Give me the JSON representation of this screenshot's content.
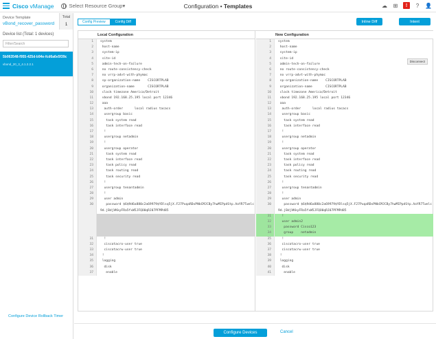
{
  "header": {
    "brand": "Cisco",
    "product": "vManage",
    "resource_group": "Select Resource Group▾",
    "title_section": "Configuration",
    "title_page": "Templates",
    "alert_count": "!"
  },
  "sidebar": {
    "device_template_label": "Device Template",
    "device_template_name": "vBond_recover_password",
    "total_label": "Total",
    "total_value": "1",
    "device_list": "Device list (Total: 1 devices)",
    "filter_placeholder": "Filter/Search",
    "device_id": "5b063548-f955-425d-b94e-fcd6a6e5f39c",
    "device_version": "vbond_20_3_4.1.2.2.1",
    "rollback_link": "Configure Device Rollback Timer"
  },
  "tabs": [
    {
      "label": "Config Preview"
    },
    {
      "label": "Config Diff"
    }
  ],
  "buttons": {
    "inline_diff": "Inline Diff",
    "intent": "Intent",
    "configure_devices": "Configure Devices",
    "cancel": "Cancel",
    "disconnect": "Disconnect"
  },
  "left_pane": {
    "title": "Local Configuration",
    "lines": [
      {
        "n": "1",
        "t": "system"
      },
      {
        "n": "2",
        "t": " host-name"
      },
      {
        "n": "3",
        "t": " system-ip"
      },
      {
        "n": "4",
        "t": " site-id"
      },
      {
        "n": "5",
        "t": " admin-tech-on-failure"
      },
      {
        "n": "6",
        "t": " no route-consistency-check"
      },
      {
        "n": "7",
        "t": " no vrrp-advt-with-phymac"
      },
      {
        "n": "8",
        "t": " sp-organization-name    CISCORTPLAB"
      },
      {
        "n": "9",
        "t": " organization-name       CISCORTPLAB"
      },
      {
        "n": "10",
        "t": " clock timezone America/Detroit"
      },
      {
        "n": "11",
        "t": " vbond 192.168.25.195 local port 12346"
      },
      {
        "n": "12",
        "t": " aaa"
      },
      {
        "n": "13",
        "t": "  auth-order      local radius tacacs"
      },
      {
        "n": "14",
        "t": "  usergroup basic"
      },
      {
        "n": "15",
        "t": "   task system read"
      },
      {
        "n": "16",
        "t": "   task interface read"
      },
      {
        "n": "17",
        "t": "  !"
      },
      {
        "n": "18",
        "t": "  usergroup netadmin"
      },
      {
        "n": "19",
        "t": "  !"
      },
      {
        "n": "20",
        "t": "  usergroup operator"
      },
      {
        "n": "21",
        "t": "   task system read"
      },
      {
        "n": "22",
        "t": "   task interface read"
      },
      {
        "n": "23",
        "t": "   task policy read"
      },
      {
        "n": "24",
        "t": "   task routing read"
      },
      {
        "n": "25",
        "t": "   task security read"
      },
      {
        "n": "26",
        "t": "  !"
      },
      {
        "n": "27",
        "t": "  usergroup tenantadmin"
      },
      {
        "n": "28",
        "t": "  !"
      },
      {
        "n": "29",
        "t": "  user admin"
      },
      {
        "n": "30",
        "t": "   password $6$9d6a880c2a69979$YDlsq5jX.F27PuqaRDxPNbCMJCBy7hwMIPpdStp.AaYR7Twelc9d.jBdjVKkyFRa5fxW5JFQO0qRJ07PFMPd85",
        "tall": true
      },
      {
        "n": "",
        "t": "",
        "blank": true
      },
      {
        "n": "",
        "t": "",
        "blank": true
      },
      {
        "n": "",
        "t": "",
        "blank": true
      },
      {
        "n": "",
        "t": "",
        "blank": true
      },
      {
        "n": "31",
        "t": "  !"
      },
      {
        "n": "32",
        "t": "  ciscotacro-user true"
      },
      {
        "n": "33",
        "t": "  ciscotacrw-user true"
      },
      {
        "n": "34",
        "t": " !"
      },
      {
        "n": "35",
        "t": " logging"
      },
      {
        "n": "36",
        "t": "  disk"
      },
      {
        "n": "37",
        "t": "   enable"
      }
    ]
  },
  "right_pane": {
    "title": "New Configuration",
    "lines": [
      {
        "n": "1",
        "t": "system"
      },
      {
        "n": "2",
        "t": " host-name"
      },
      {
        "n": "3",
        "t": " system-ip"
      },
      {
        "n": "4",
        "t": " site-id"
      },
      {
        "n": "5",
        "t": " admin-tech-on-failure"
      },
      {
        "n": "6",
        "t": " no route-consistency-check"
      },
      {
        "n": "7",
        "t": " no vrrp-advt-with-phymac"
      },
      {
        "n": "8",
        "t": " sp-organization-name    CISCORTPLAB"
      },
      {
        "n": "9",
        "t": " organization-name       CISCORTPLAB"
      },
      {
        "n": "10",
        "t": " clock timezone America/Detroit"
      },
      {
        "n": "11",
        "t": " vbond 192.168.25.195 local port 12346"
      },
      {
        "n": "12",
        "t": " aaa"
      },
      {
        "n": "13",
        "t": "  auth-order      local radius tacacs"
      },
      {
        "n": "14",
        "t": "  usergroup basic"
      },
      {
        "n": "15",
        "t": "   task system read"
      },
      {
        "n": "16",
        "t": "   task interface read"
      },
      {
        "n": "17",
        "t": "  !"
      },
      {
        "n": "18",
        "t": "  usergroup netadmin"
      },
      {
        "n": "19",
        "t": "  !"
      },
      {
        "n": "20",
        "t": "  usergroup operator"
      },
      {
        "n": "21",
        "t": "   task system read"
      },
      {
        "n": "22",
        "t": "   task interface read"
      },
      {
        "n": "23",
        "t": "   task policy read"
      },
      {
        "n": "24",
        "t": "   task routing read"
      },
      {
        "n": "25",
        "t": "   task security read"
      },
      {
        "n": "26",
        "t": "  !"
      },
      {
        "n": "27",
        "t": "  usergroup tenantadmin"
      },
      {
        "n": "28",
        "t": "  !"
      },
      {
        "n": "29",
        "t": "  user admin"
      },
      {
        "n": "30",
        "t": "   password $6$9d6a880c2a69979$YDlsq5jX.F27PuqaRDxPNbCMJCBy7hwMIPpdStp.AaYR7Twelc9d.jBdjVKkyFRa5fxW5JFQO0qRJ07PFMPd85",
        "tall": true
      },
      {
        "n": "31",
        "t": "  !",
        "added": true
      },
      {
        "n": "32",
        "t": "  user admin2",
        "added": true
      },
      {
        "n": "33",
        "t": "   password Cisco123",
        "added": true
      },
      {
        "n": "34",
        "t": "   group    netadmin",
        "added": true
      },
      {
        "n": "35",
        "t": "  !"
      },
      {
        "n": "36",
        "t": "  ciscotacro-user true"
      },
      {
        "n": "37",
        "t": "  ciscotacrw-user true"
      },
      {
        "n": "38",
        "t": " !"
      },
      {
        "n": "39",
        "t": " logging"
      },
      {
        "n": "40",
        "t": "  disk"
      },
      {
        "n": "41",
        "t": "   enable"
      }
    ]
  }
}
